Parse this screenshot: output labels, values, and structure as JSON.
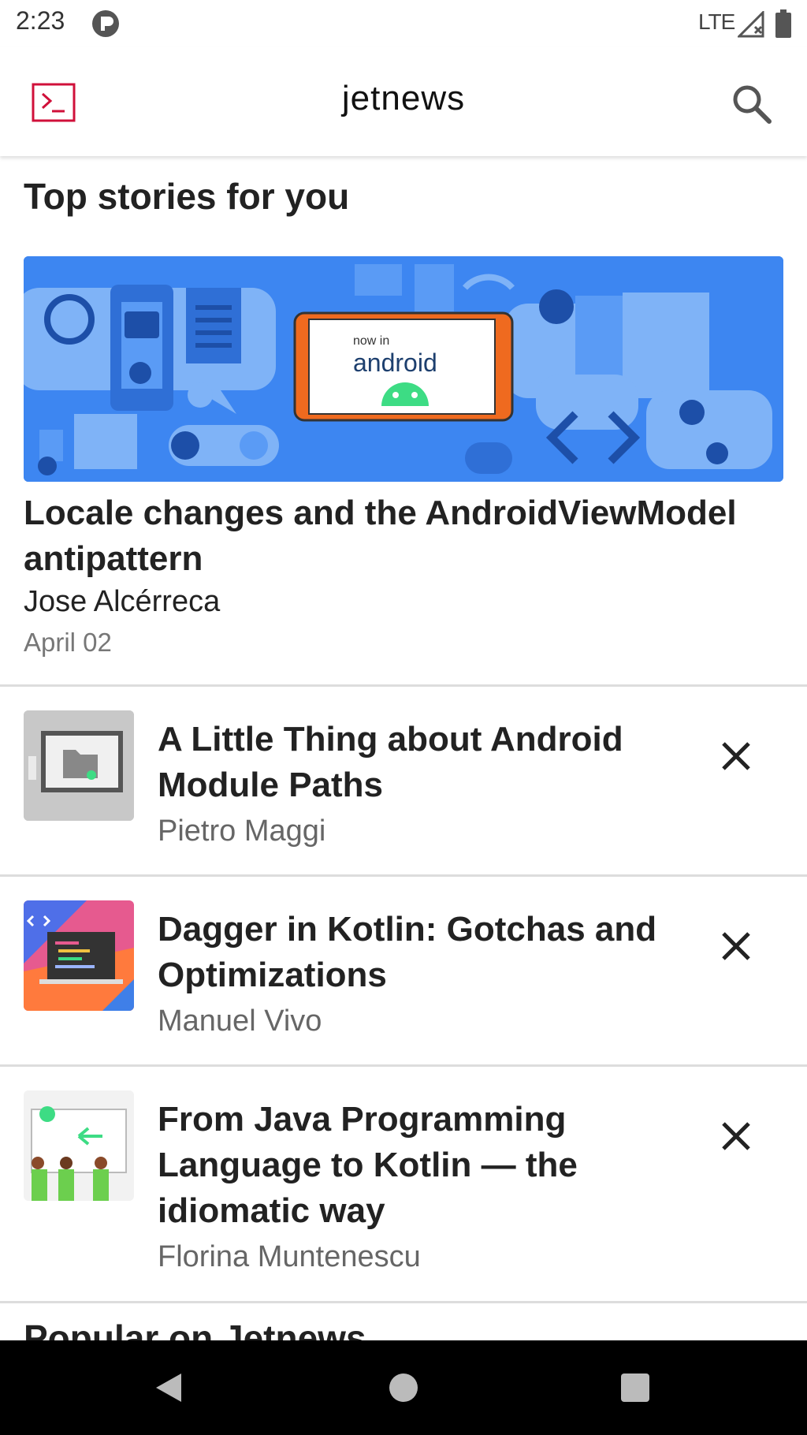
{
  "status_bar": {
    "time": "2:23",
    "network": "LTE",
    "icons": [
      "app-notification-icon",
      "signal-icon",
      "battery-icon"
    ]
  },
  "app_bar": {
    "title": "jetnews",
    "menu_icon": "jetnews-logo-icon",
    "search_icon": "search-icon",
    "accent_color": "#d0103a"
  },
  "top_stories": {
    "heading": "Top stories for you",
    "featured": {
      "title": "Locale changes and the AndroidViewModel antipattern",
      "author": "Jose Alcérreca",
      "date": "April 02",
      "image_text_small": "now in",
      "image_text_large": "android"
    }
  },
  "posts": [
    {
      "title": "A Little Thing about Android Module Paths",
      "author": "Pietro Maggi",
      "thumb": "folder-screen"
    },
    {
      "title": "Dagger in Kotlin: Gotchas and Optimizations",
      "author": "Manuel Vivo",
      "thumb": "laptop-code"
    },
    {
      "title": "From Java Programming Language to Kotlin — the idiomatic way",
      "author": "Florina Muntenescu",
      "thumb": "hands-screen"
    }
  ],
  "popular": {
    "heading": "Popular on Jetnews"
  },
  "nav_bar": {
    "buttons": [
      "back-icon",
      "home-icon",
      "recents-icon"
    ]
  }
}
